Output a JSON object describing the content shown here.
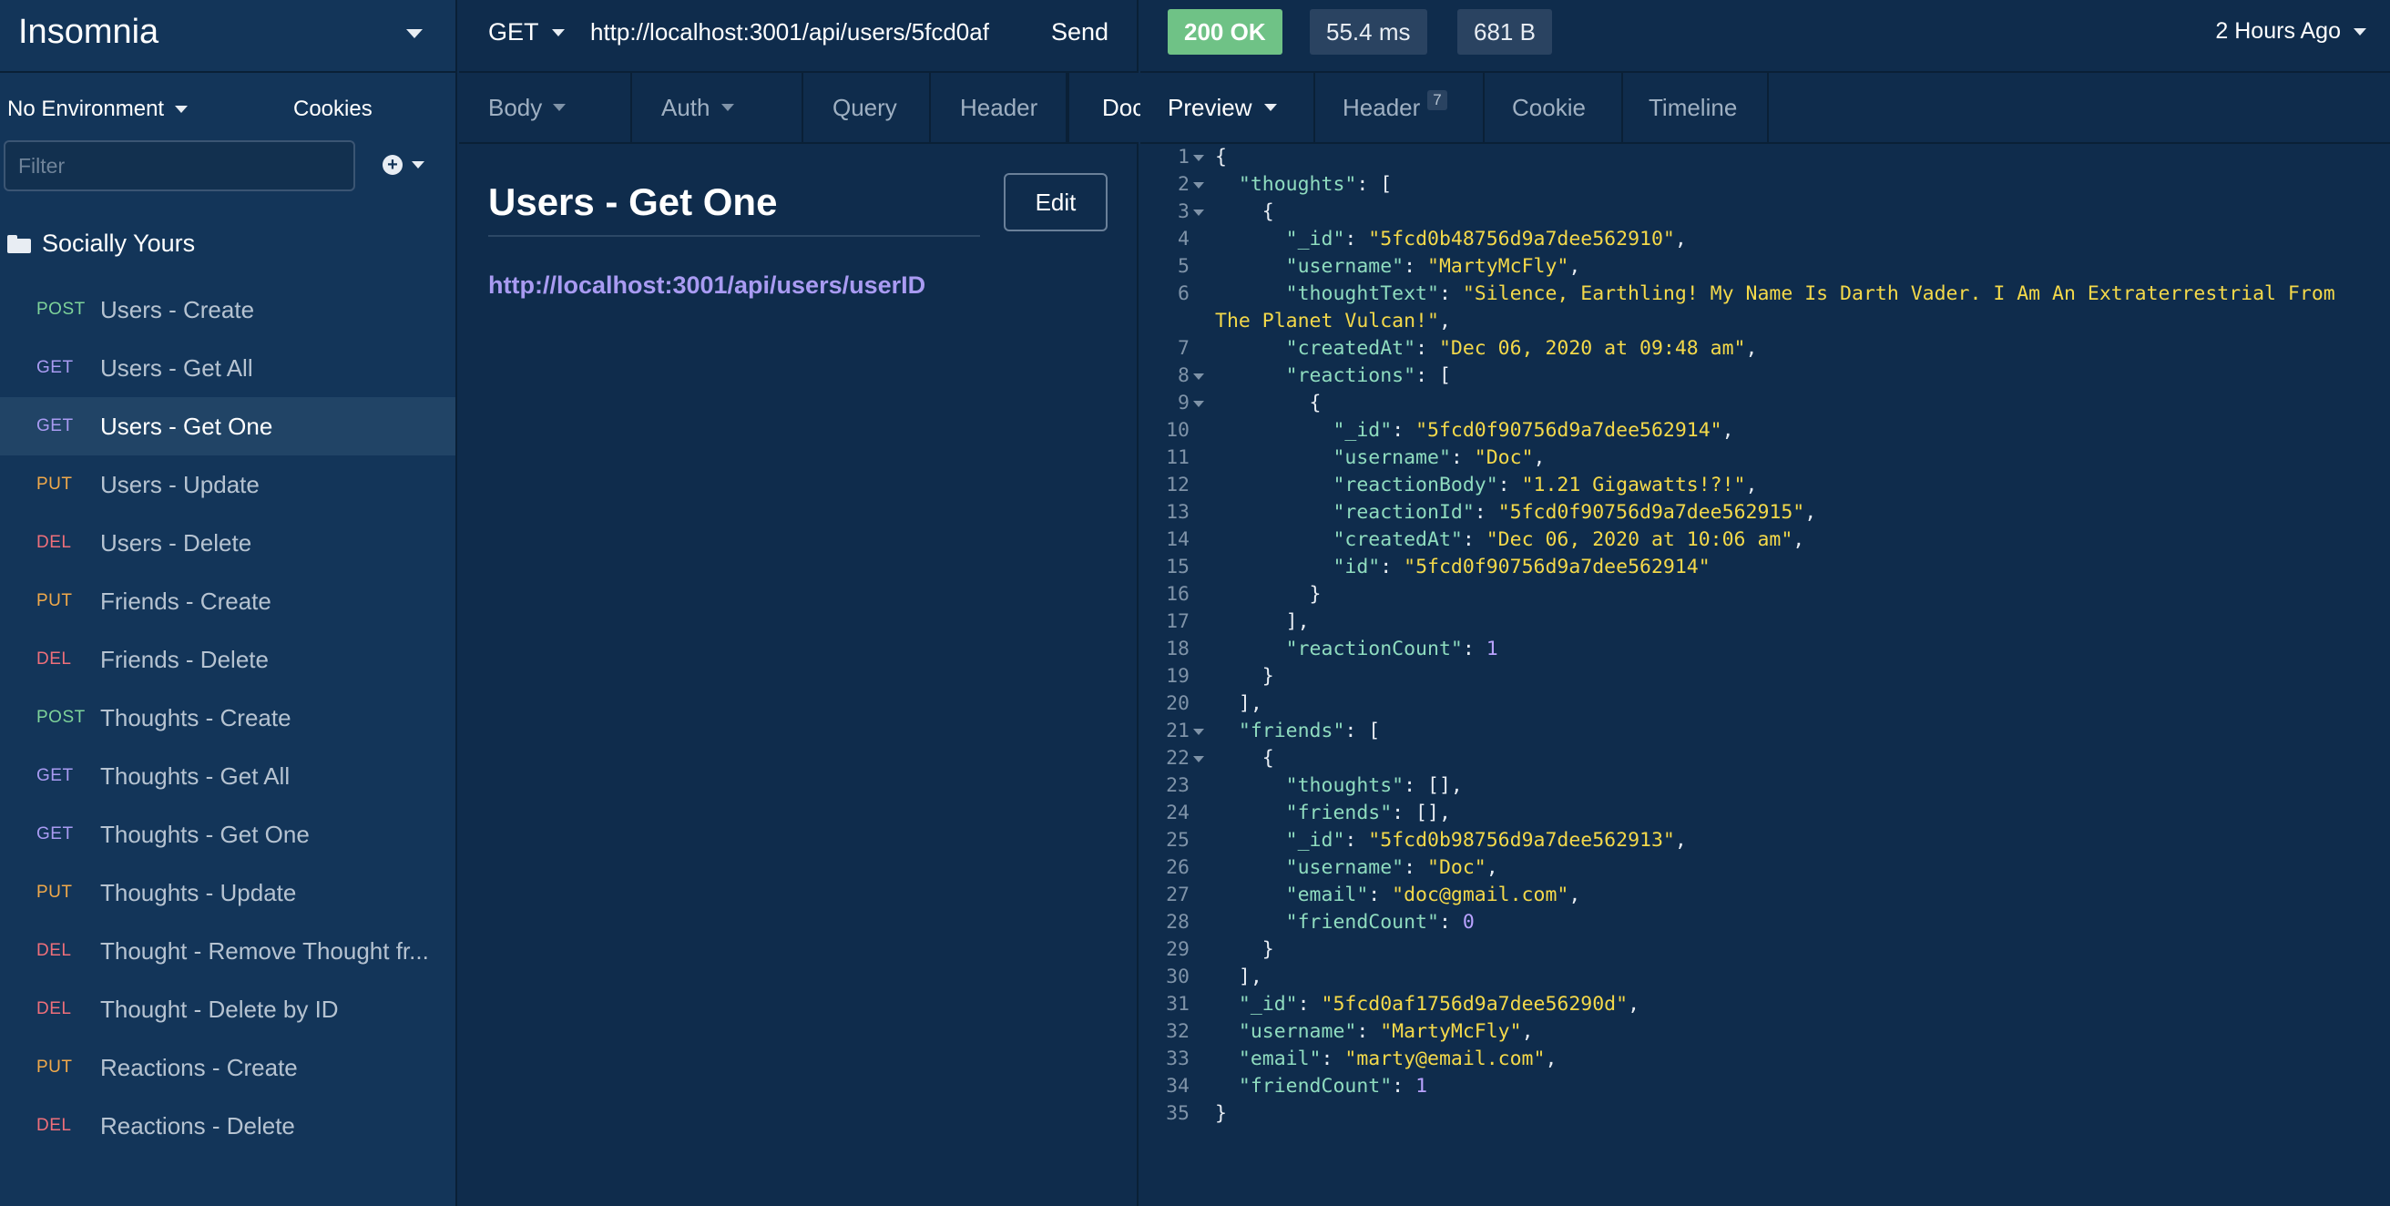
{
  "sidebar": {
    "app_title": "Insomnia",
    "environment": "No Environment",
    "cookies": "Cookies",
    "filter_placeholder": "Filter",
    "workspace": "Socially Yours",
    "items": [
      {
        "method": "POST",
        "name": "Users - Create"
      },
      {
        "method": "GET",
        "name": "Users - Get All"
      },
      {
        "method": "GET",
        "name": "Users - Get One",
        "active": true
      },
      {
        "method": "PUT",
        "name": "Users - Update"
      },
      {
        "method": "DEL",
        "name": "Users - Delete"
      },
      {
        "method": "PUT",
        "name": "Friends - Create"
      },
      {
        "method": "DEL",
        "name": "Friends - Delete"
      },
      {
        "method": "POST",
        "name": "Thoughts - Create"
      },
      {
        "method": "GET",
        "name": "Thoughts - Get All"
      },
      {
        "method": "GET",
        "name": "Thoughts - Get One"
      },
      {
        "method": "PUT",
        "name": "Thoughts - Update"
      },
      {
        "method": "DEL",
        "name": "Thought - Remove Thought fr..."
      },
      {
        "method": "DEL",
        "name": "Thought - Delete by ID"
      },
      {
        "method": "PUT",
        "name": "Reactions - Create"
      },
      {
        "method": "DEL",
        "name": "Reactions - Delete"
      }
    ]
  },
  "request": {
    "method": "GET",
    "url": "http://localhost:3001/api/users/5fcd0af",
    "send": "Send",
    "tabs": [
      {
        "label": "Body",
        "caret": true,
        "width": 190
      },
      {
        "label": "Auth",
        "caret": true,
        "width": 188
      },
      {
        "label": "Query",
        "caret": false,
        "width": 140
      },
      {
        "label": "Header",
        "caret": false,
        "width": 150
      },
      {
        "label": "Docs",
        "caret": false,
        "width": 130,
        "active": true,
        "check": true
      }
    ],
    "docs": {
      "title": "Users - Get One",
      "edit": "Edit",
      "url": "http://localhost:3001/api/users/userID"
    }
  },
  "response": {
    "status": "200 OK",
    "time": "55.4 ms",
    "size": "681 B",
    "age": "2 Hours Ago",
    "tabs": [
      {
        "label": "Preview",
        "caret": true,
        "active": true
      },
      {
        "label": "Header",
        "count": "7"
      },
      {
        "label": "Cookie"
      },
      {
        "label": "Timeline"
      }
    ],
    "code_lines": [
      {
        "n": "1",
        "fold": true,
        "tokens": [
          [
            "p",
            "{"
          ]
        ]
      },
      {
        "n": "2",
        "fold": true,
        "tokens": [
          [
            "p",
            "  "
          ],
          [
            "k",
            "\"thoughts\""
          ],
          [
            "p",
            ": ["
          ]
        ]
      },
      {
        "n": "3",
        "fold": true,
        "tokens": [
          [
            "p",
            "    {"
          ]
        ]
      },
      {
        "n": "4",
        "tokens": [
          [
            "p",
            "      "
          ],
          [
            "k",
            "\"_id\""
          ],
          [
            "p",
            ": "
          ],
          [
            "s",
            "\"5fcd0b48756d9a7dee562910\""
          ],
          [
            "p",
            ","
          ]
        ]
      },
      {
        "n": "5",
        "tokens": [
          [
            "p",
            "      "
          ],
          [
            "k",
            "\"username\""
          ],
          [
            "p",
            ": "
          ],
          [
            "s",
            "\"MartyMcFly\""
          ],
          [
            "p",
            ","
          ]
        ]
      },
      {
        "n": "6",
        "tokens": [
          [
            "p",
            "      "
          ],
          [
            "k",
            "\"thoughtText\""
          ],
          [
            "p",
            ": "
          ],
          [
            "s",
            "\"Silence, Earthling! My Name Is Darth Vader. I Am An Extraterrestrial From"
          ]
        ]
      },
      {
        "n": "",
        "tokens": [
          [
            "s",
            "The Planet Vulcan!\""
          ],
          [
            "p",
            ","
          ]
        ]
      },
      {
        "n": "7",
        "tokens": [
          [
            "p",
            "      "
          ],
          [
            "k",
            "\"createdAt\""
          ],
          [
            "p",
            ": "
          ],
          [
            "s",
            "\"Dec 06, 2020 at 09:48 am\""
          ],
          [
            "p",
            ","
          ]
        ]
      },
      {
        "n": "8",
        "fold": true,
        "tokens": [
          [
            "p",
            "      "
          ],
          [
            "k",
            "\"reactions\""
          ],
          [
            "p",
            ": ["
          ]
        ]
      },
      {
        "n": "9",
        "fold": true,
        "tokens": [
          [
            "p",
            "        {"
          ]
        ]
      },
      {
        "n": "10",
        "tokens": [
          [
            "p",
            "          "
          ],
          [
            "k",
            "\"_id\""
          ],
          [
            "p",
            ": "
          ],
          [
            "s",
            "\"5fcd0f90756d9a7dee562914\""
          ],
          [
            "p",
            ","
          ]
        ]
      },
      {
        "n": "11",
        "tokens": [
          [
            "p",
            "          "
          ],
          [
            "k",
            "\"username\""
          ],
          [
            "p",
            ": "
          ],
          [
            "s",
            "\"Doc\""
          ],
          [
            "p",
            ","
          ]
        ]
      },
      {
        "n": "12",
        "tokens": [
          [
            "p",
            "          "
          ],
          [
            "k",
            "\"reactionBody\""
          ],
          [
            "p",
            ": "
          ],
          [
            "s",
            "\"1.21 Gigawatts!?!\""
          ],
          [
            "p",
            ","
          ]
        ]
      },
      {
        "n": "13",
        "tokens": [
          [
            "p",
            "          "
          ],
          [
            "k",
            "\"reactionId\""
          ],
          [
            "p",
            ": "
          ],
          [
            "s",
            "\"5fcd0f90756d9a7dee562915\""
          ],
          [
            "p",
            ","
          ]
        ]
      },
      {
        "n": "14",
        "tokens": [
          [
            "p",
            "          "
          ],
          [
            "k",
            "\"createdAt\""
          ],
          [
            "p",
            ": "
          ],
          [
            "s",
            "\"Dec 06, 2020 at 10:06 am\""
          ],
          [
            "p",
            ","
          ]
        ]
      },
      {
        "n": "15",
        "tokens": [
          [
            "p",
            "          "
          ],
          [
            "k",
            "\"id\""
          ],
          [
            "p",
            ": "
          ],
          [
            "s",
            "\"5fcd0f90756d9a7dee562914\""
          ]
        ]
      },
      {
        "n": "16",
        "tokens": [
          [
            "p",
            "        }"
          ]
        ]
      },
      {
        "n": "17",
        "tokens": [
          [
            "p",
            "      ],"
          ]
        ]
      },
      {
        "n": "18",
        "tokens": [
          [
            "p",
            "      "
          ],
          [
            "k",
            "\"reactionCount\""
          ],
          [
            "p",
            ": "
          ],
          [
            "n",
            "1"
          ]
        ]
      },
      {
        "n": "19",
        "tokens": [
          [
            "p",
            "    }"
          ]
        ]
      },
      {
        "n": "20",
        "tokens": [
          [
            "p",
            "  ],"
          ]
        ]
      },
      {
        "n": "21",
        "fold": true,
        "tokens": [
          [
            "p",
            "  "
          ],
          [
            "k",
            "\"friends\""
          ],
          [
            "p",
            ": ["
          ]
        ]
      },
      {
        "n": "22",
        "fold": true,
        "tokens": [
          [
            "p",
            "    {"
          ]
        ]
      },
      {
        "n": "23",
        "tokens": [
          [
            "p",
            "      "
          ],
          [
            "k",
            "\"thoughts\""
          ],
          [
            "p",
            ": [],"
          ]
        ]
      },
      {
        "n": "24",
        "tokens": [
          [
            "p",
            "      "
          ],
          [
            "k",
            "\"friends\""
          ],
          [
            "p",
            ": [],"
          ]
        ]
      },
      {
        "n": "25",
        "tokens": [
          [
            "p",
            "      "
          ],
          [
            "k",
            "\"_id\""
          ],
          [
            "p",
            ": "
          ],
          [
            "s",
            "\"5fcd0b98756d9a7dee562913\""
          ],
          [
            "p",
            ","
          ]
        ]
      },
      {
        "n": "26",
        "tokens": [
          [
            "p",
            "      "
          ],
          [
            "k",
            "\"username\""
          ],
          [
            "p",
            ": "
          ],
          [
            "s",
            "\"Doc\""
          ],
          [
            "p",
            ","
          ]
        ]
      },
      {
        "n": "27",
        "tokens": [
          [
            "p",
            "      "
          ],
          [
            "k",
            "\"email\""
          ],
          [
            "p",
            ": "
          ],
          [
            "s",
            "\"doc@gmail.com\""
          ],
          [
            "p",
            ","
          ]
        ]
      },
      {
        "n": "28",
        "tokens": [
          [
            "p",
            "      "
          ],
          [
            "k",
            "\"friendCount\""
          ],
          [
            "p",
            ": "
          ],
          [
            "n",
            "0"
          ]
        ]
      },
      {
        "n": "29",
        "tokens": [
          [
            "p",
            "    }"
          ]
        ]
      },
      {
        "n": "30",
        "tokens": [
          [
            "p",
            "  ],"
          ]
        ]
      },
      {
        "n": "31",
        "tokens": [
          [
            "p",
            "  "
          ],
          [
            "k",
            "\"_id\""
          ],
          [
            "p",
            ": "
          ],
          [
            "s",
            "\"5fcd0af1756d9a7dee56290d\""
          ],
          [
            "p",
            ","
          ]
        ]
      },
      {
        "n": "32",
        "tokens": [
          [
            "p",
            "  "
          ],
          [
            "k",
            "\"username\""
          ],
          [
            "p",
            ": "
          ],
          [
            "s",
            "\"MartyMcFly\""
          ],
          [
            "p",
            ","
          ]
        ]
      },
      {
        "n": "33",
        "tokens": [
          [
            "p",
            "  "
          ],
          [
            "k",
            "\"email\""
          ],
          [
            "p",
            ": "
          ],
          [
            "s",
            "\"marty@email.com\""
          ],
          [
            "p",
            ","
          ]
        ]
      },
      {
        "n": "34",
        "tokens": [
          [
            "p",
            "  "
          ],
          [
            "k",
            "\"friendCount\""
          ],
          [
            "p",
            ": "
          ],
          [
            "n",
            "1"
          ]
        ]
      },
      {
        "n": "35",
        "tokens": [
          [
            "p",
            "}"
          ]
        ]
      }
    ]
  },
  "colors": {
    "background": "#0f2c4c",
    "sidebar": "#133559",
    "status_ok": "#6fc286",
    "get": "#a99bf2",
    "post": "#7ed39a",
    "put": "#f0a94a",
    "del": "#ee6f7a"
  },
  "icons": [
    "chevron-down-icon",
    "plus-circle-icon",
    "folder-open-icon",
    "check-icon"
  ]
}
